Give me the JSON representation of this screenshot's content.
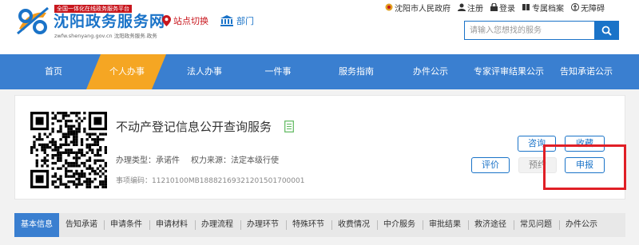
{
  "header": {
    "logo_top": "全国一体化在线政务服务平台",
    "logo_title": "沈阳政务服务网",
    "logo_sub": "zwfw.shenyang.gov.cn 沈阳政务服务.政务",
    "location_label": "站点切换",
    "dept_label": "部门",
    "top_links": [
      "沈阳市人民政府",
      "注册",
      "登录",
      "专属档案",
      "无障碍"
    ],
    "search_placeholder": "请输入您想找的服务"
  },
  "nav": {
    "items": [
      "首页",
      "个人办事",
      "法人办事",
      "一件事",
      "服务指南",
      "办件公示",
      "专家评审结果公示",
      "告知承诺公示"
    ],
    "active_index": 1
  },
  "service": {
    "title": "不动产登记信息公开查询服务",
    "type_label": "办理类型：",
    "type_value": "承诺件",
    "source_label": "权力来源：",
    "source_value": "法定本级行使",
    "code_label": "事项编码：",
    "code_value": "11210100MB18882169321201501700001",
    "buttons": {
      "consult": "咨询",
      "favorite": "收藏",
      "evaluate": "评价",
      "preview": "预约",
      "apply": "申报"
    }
  },
  "tabs": {
    "items": [
      "基本信息",
      "告知承诺",
      "申请条件",
      "申请材料",
      "办理流程",
      "办理环节",
      "特殊环节",
      "收费情况",
      "中介服务",
      "审批结果",
      "救济途径",
      "常见问题",
      "办件公示"
    ],
    "active_index": 0
  },
  "colors": {
    "brand_blue": "#1a73c8",
    "nav_blue": "#3a7fd0",
    "active_orange": "#f5a623",
    "highlight_red": "#e01f26"
  }
}
